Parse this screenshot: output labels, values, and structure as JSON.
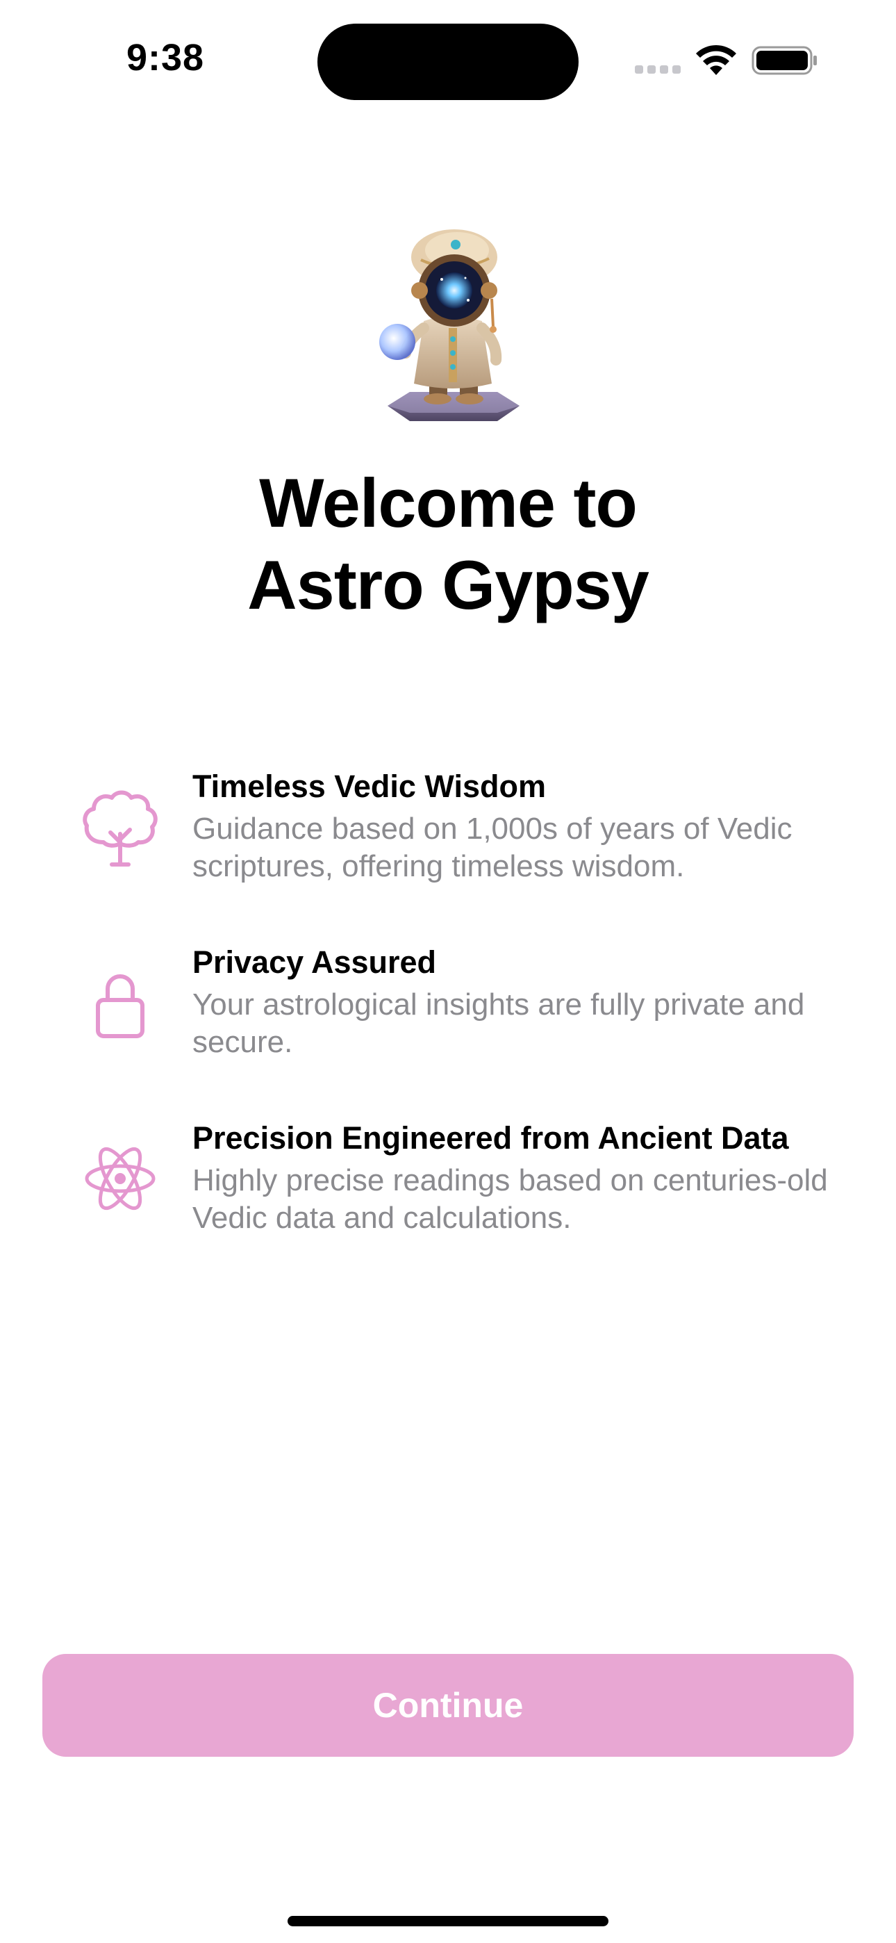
{
  "status_bar": {
    "time": "9:38"
  },
  "welcome": {
    "title_line1": "Welcome to",
    "title_line2": "Astro Gypsy"
  },
  "features": [
    {
      "icon": "tree-icon",
      "title": "Timeless Vedic Wisdom",
      "description": "Guidance based on 1,000s of years of Vedic scriptures, offering timeless wisdom."
    },
    {
      "icon": "lock-icon",
      "title": "Privacy Assured",
      "description": "Your astrological insights are fully private and secure."
    },
    {
      "icon": "atom-icon",
      "title": "Precision Engineered from Ancient Data",
      "description": "Highly precise readings based on centuries-old Vedic data and calculations."
    }
  ],
  "continue_button": {
    "label": "Continue"
  },
  "colors": {
    "accent": "#e8a7d3",
    "icon_pink": "#e497cf",
    "secondary_text": "#8a8a8e"
  }
}
